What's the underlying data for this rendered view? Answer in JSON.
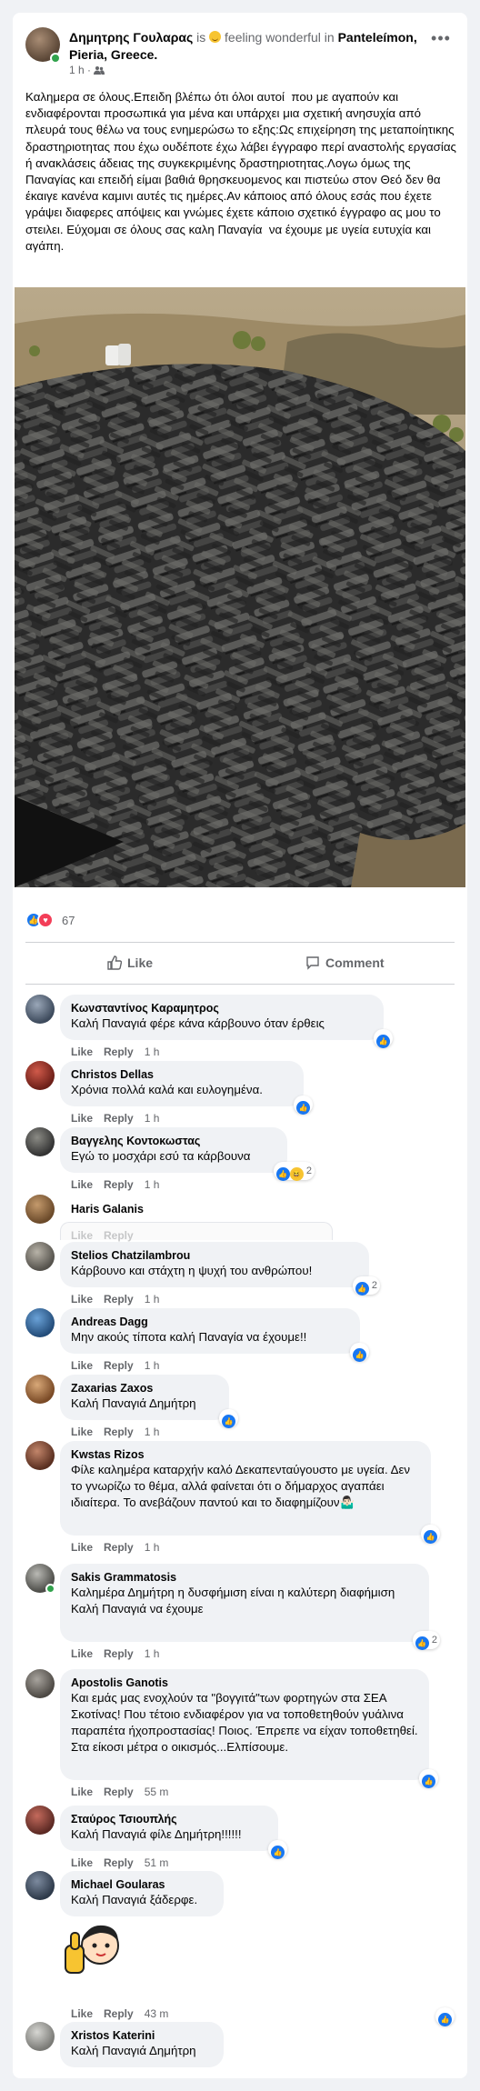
{
  "post": {
    "author": "Δημητρης Γουλαρας",
    "is_word": "is",
    "feeling": "feeling wonderful",
    "in_word": "in",
    "location": "Panteleímon, Pieria, Greece.",
    "time": "1 h",
    "privacy_icon": "friends-icon",
    "text": "Καλημερα σε όλους.Επειδη βλέπω ότι όλοι αυτοί  που με αγαπούν και ενδιαφέρονται προσωπικά για μένα και υπάρχει μια σχετική ανησυχία από πλευρά τους θέλω να τους ενημερώσω το εξης:Ως επιχείρηση της μεταποίητικης δραστηριοτητας που έχω ουδέποτε έχω λάβει έγγραφο περί αναστολής εργασίας ή ανακλάσεις άδειας της συγκεκριμένης δραστηριοτητας.Λογω όμως της Παναγίας και επειδή είμαι βαθιά θρησκευομενος και πιστεύω στον Θεό δεν θα έκαιγε κανένα καμινι αυτές τις ημέρες.Αν κάποιος από όλους εσάς που έχετε γράψει διαφερες απόψεις και γνώμες έχετε κάποιο σχετικό έγγραφο ας μου το στειλει. Εύχομαι σε όλους σας καλη Παναγία  να έχουμε με υγεία ευτυχία και αγάπη.",
    "reaction_count": "67",
    "like_label": "Like",
    "comment_label": "Comment"
  },
  "comments": [
    {
      "name": "Κωνσταντίνος Καραμητρος",
      "text": "Καλή Παναγιά φέρε κάνα κάρβουνο όταν έρθεις",
      "like": "Like",
      "reply": "Reply",
      "time": "1 h",
      "reaction_count": ""
    },
    {
      "name": "Christos Dellas",
      "text": "Χρόνια πολλά καλά και ευλογημένα.",
      "like": "Like",
      "reply": "Reply",
      "time": "1 h",
      "reaction_count": ""
    },
    {
      "name": "Βαγγελης Κοντοκωστας",
      "text": "Εγώ το μοσχάρι εσύ τα κάρβουνα",
      "like": "Like",
      "reply": "Reply",
      "time": "1 h",
      "reaction_count": "2"
    },
    {
      "name": "Haris Galanis",
      "text": "",
      "like": "Like",
      "reply": "Reply",
      "time": "",
      "reaction_count": ""
    },
    {
      "name": "Stelios Chatzilambrou",
      "text": "Κάρβουνο και στάχτη η ψυχή του ανθρώπου!",
      "like": "Like",
      "reply": "Reply",
      "time": "1 h",
      "reaction_count": "2"
    },
    {
      "name": "Andreas Dagg",
      "text": "Μην ακούς τίποτα καλή Παναγία να έχουμε!!",
      "like": "Like",
      "reply": "Reply",
      "time": "1 h",
      "reaction_count": ""
    },
    {
      "name": "Zaxarias Zaxos",
      "text": "Καλή Παναγιά Δημήτρη",
      "like": "Like",
      "reply": "Reply",
      "time": "1 h",
      "reaction_count": ""
    },
    {
      "name": "Kwstas Rizos",
      "text": "Φίλε καλημέρα καταρχήν καλό Δεκαπενταύγουστο με υγεία. Δεν το γνωρίζω το θέμα, αλλά φαίνεται ότι ο δήμαρχος αγαπάει ιδιαίτερα. Το ανεβάζουν παντού και το διαφημίζουν🤷🏻‍♂️",
      "like": "Like",
      "reply": "Reply",
      "time": "1 h",
      "reaction_count": ""
    },
    {
      "name": "Sakis Grammatosis",
      "text": "Καλημέρα Δημήτρη η δυσφήμιση είναι η καλύτερη διαφήμιση\nΚαλή Παναγιά να έχουμε",
      "like": "Like",
      "reply": "Reply",
      "time": "1 h",
      "reaction_count": "2"
    },
    {
      "name": "Apostolis Ganotis",
      "text": "Και εμάς μας ενοχλούν τα \"βογγιτά\"των φορτηγών στα ΣΕΑ Σκοτίνας! Που τέτοιο ενδιαφέρον για να τοποθετηθούν γυάλινα παραπέτα ήχοπροστασίας! Ποιος. Έπρεπε να είχαν τοποθετηθεί. Στα είκοσι μέτρα ο οικισμός...Ελπίσουμε.",
      "like": "Like",
      "reply": "Reply",
      "time": "55 m",
      "reaction_count": ""
    },
    {
      "name": "Σταύρος Τσιουπλής",
      "text": "Καλή Παναγιά φίλε Δημήτρη!!!!!!",
      "like": "Like",
      "reply": "Reply",
      "time": "51 m",
      "reaction_count": ""
    },
    {
      "name": "Michael Goularas",
      "text": "Καλή Παναγιά ξάδερφε.",
      "like": "Like",
      "reply": "Reply",
      "time": "43 m",
      "reaction_count": ""
    },
    {
      "name": "Xristos Katerini",
      "text": "Καλή Παναγιά Δημήτρη",
      "like": "",
      "reply": "",
      "time": "",
      "reaction_count": ""
    }
  ],
  "colors": {
    "accent": "#1877f2",
    "love": "#f33e58",
    "online": "#31a24c",
    "bubble": "#f0f2f5"
  }
}
